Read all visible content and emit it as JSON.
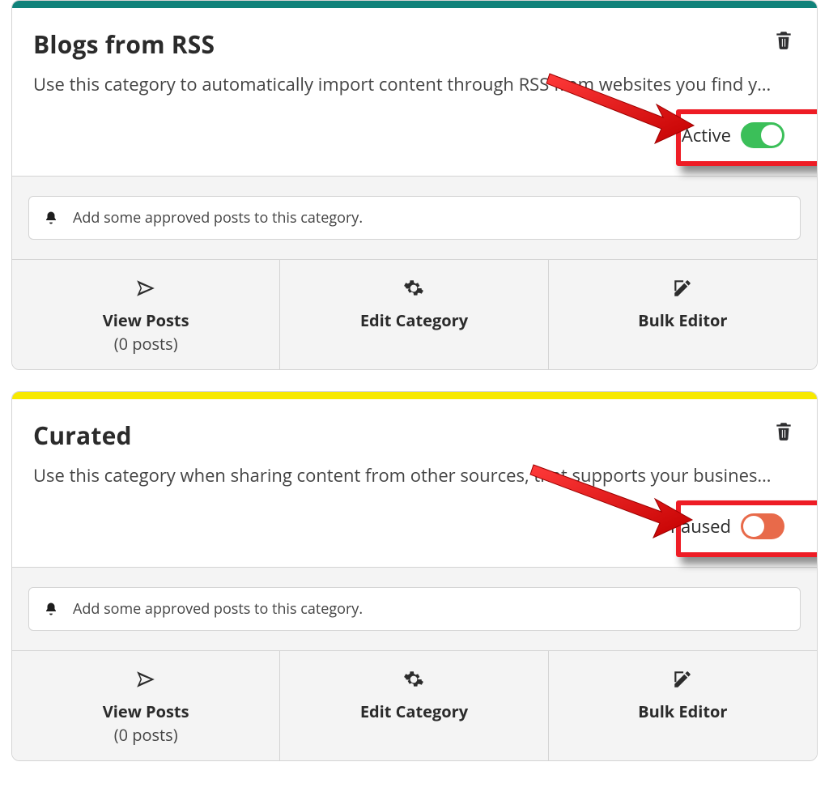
{
  "cards": [
    {
      "stripeClass": "stripe-teal",
      "title": "Blogs from RSS",
      "description": "Use this category to automatically import content through RSS from websites you find y…",
      "toggle": {
        "label": "Active",
        "on": true
      },
      "notice": "Add some approved posts to this category.",
      "actions": {
        "view": {
          "title": "View Posts",
          "sub": "(0 posts)"
        },
        "edit": {
          "title": "Edit Category"
        },
        "bulk": {
          "title": "Bulk Editor"
        }
      }
    },
    {
      "stripeClass": "stripe-yellow",
      "title": "Curated",
      "description": "Use this category when sharing content from other sources, that supports your busines…",
      "toggle": {
        "label": "Paused",
        "on": false
      },
      "notice": "Add some approved posts to this category.",
      "actions": {
        "view": {
          "title": "View Posts",
          "sub": "(0 posts)"
        },
        "edit": {
          "title": "Edit Category"
        },
        "bulk": {
          "title": "Bulk Editor"
        }
      }
    }
  ]
}
